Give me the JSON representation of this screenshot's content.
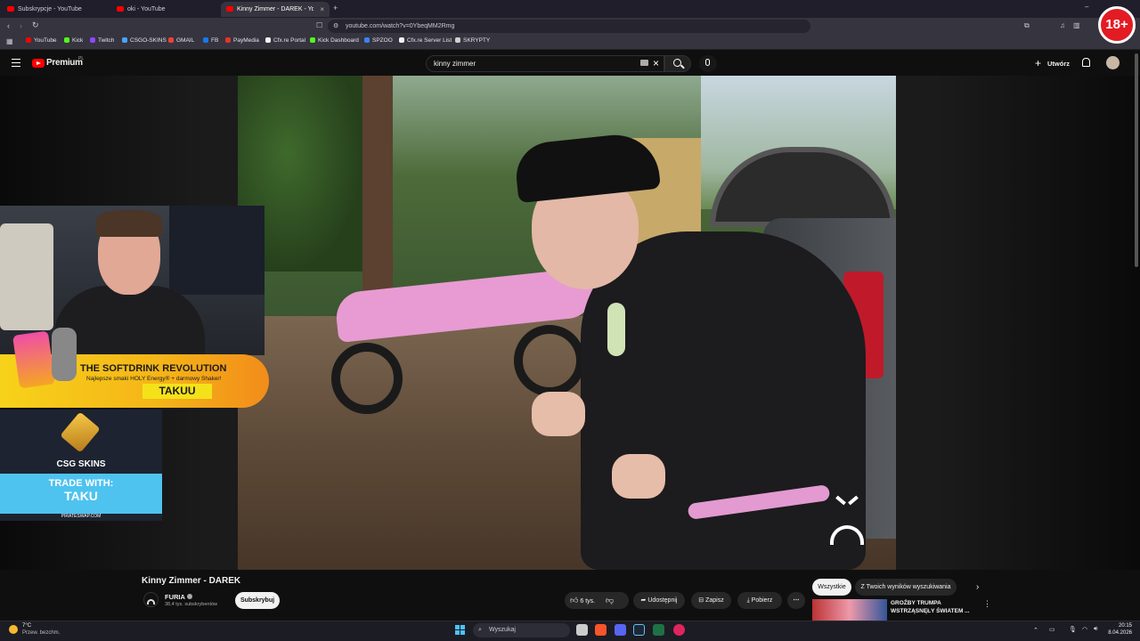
{
  "browser": {
    "tabs": [
      {
        "title": "Subskrypcje - YouTube"
      },
      {
        "title": "oki - YouTube"
      },
      {
        "title": "Kinny Zimmer - DAREK - YouTube"
      }
    ],
    "new_tab_symbol": "+",
    "close_symbol": "×",
    "url": "youtube.com/watch?v=0YbeqMM2Rmg",
    "bookmarks": [
      "YouTube",
      "Kick",
      "Twitch",
      "CSGO-SKINS",
      "GMAIL",
      "FB",
      "PayMedia",
      "Cfx.re Portal",
      "Kick Dashboard",
      "SPZOO",
      "Cfx.re Server List",
      "SKRYPTY"
    ],
    "bookmark_colors": [
      "#ff0000",
      "#53fc18",
      "#9146ff",
      "#4aa3ff",
      "#ea4335",
      "#1877f2",
      "#e6332a",
      "#f5f5f5",
      "#53fc18",
      "#3b82f6",
      "#f5f5f5",
      "#cfcfcf"
    ]
  },
  "youtube": {
    "logo_text": "Premium",
    "logo_region": "PL",
    "search_query": "kinny zimmer",
    "create_label": "Utwórz",
    "video": {
      "title": "Kinny Zimmer - DAREK",
      "channel": "FURIA",
      "subscribers": "38,4 tys. subskrybentów",
      "subscribe_label": "Subskrybuj",
      "likes": "6 tys.",
      "share_label": "Udostępnij",
      "save_label": "Zapisz",
      "download_label": "Pobierz"
    },
    "chips": [
      "Wszystkie",
      "Z Twoich wyników wyszukiwania"
    ],
    "recommended": {
      "title": "GROŹBY TRUMPA WSTRZĄSNĘŁY ŚWIATEM ..."
    }
  },
  "overlay": {
    "badge": "18+",
    "promo_title": "THE SOFTDRINK REVOLUTION",
    "promo_sub": "Najlepsze smaki HOLY Energy® + darmowy Shaker!",
    "promo_code": "TAKUU",
    "csg_brand": "CSG SKINS",
    "trade_line1": "TRADE WITH:",
    "trade_line2": "TAKU",
    "trade_site": "PIRATESWAP.COM"
  },
  "taskbar": {
    "weather_temp": "7°C",
    "weather_desc": "Przew. bezchm.",
    "search_placeholder": "Wyszukaj",
    "time": "20:15",
    "date": "8.04.2026"
  }
}
